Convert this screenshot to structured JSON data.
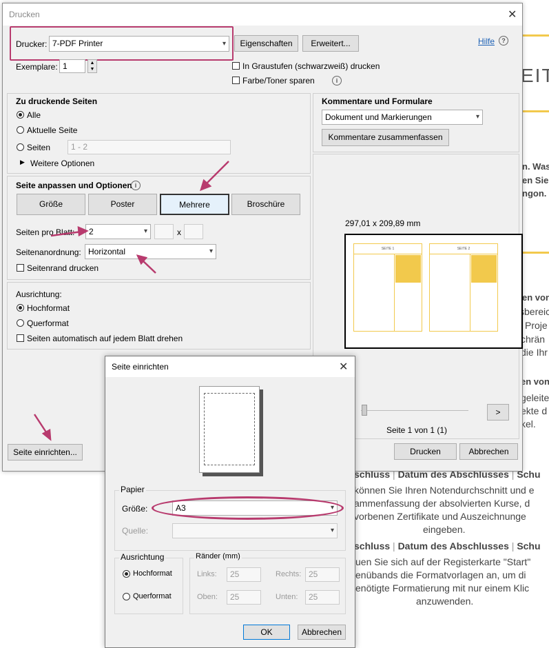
{
  "print_dialog": {
    "title": "Drucken",
    "printer_label": "Drucker:",
    "printer_value": "7-PDF Printer",
    "properties_button": "Eigenschaften",
    "advanced_button": "Erweitert...",
    "help_link": "Hilfe",
    "copies_label": "Exemplare:",
    "copies_value": "1",
    "grayscale_label": "In Graustufen (schwarzweiß) drucken",
    "save_toner_label": "Farbe/Toner sparen",
    "pages_section": {
      "title": "Zu druckende Seiten",
      "all": "Alle",
      "current": "Aktuelle Seite",
      "pages": "Seiten",
      "pages_value": "1 - 2",
      "more_options": "Weitere Optionen"
    },
    "comments_section": {
      "title": "Kommentare und Formulare",
      "select_value": "Dokument und Markierungen",
      "summarize_button": "Kommentare zusammenfassen"
    },
    "fit_section": {
      "title": "Seite anpassen und Optionen",
      "size_button": "Größe",
      "poster_button": "Poster",
      "multiple_button": "Mehrere",
      "booklet_button": "Broschüre",
      "pages_per_sheet_label": "Seiten pro Blatt:",
      "pages_per_sheet_value": "2",
      "times": "x",
      "page_order_label": "Seitenanordnung:",
      "page_order_value": "Horizontal",
      "print_border_label": "Seitenrand drucken"
    },
    "orientation_section": {
      "title": "Ausrichtung:",
      "portrait": "Hochformat",
      "landscape": "Querformat",
      "auto_rotate": "Seiten automatisch auf jedem Blatt drehen"
    },
    "preview": {
      "dimensions": "297,01 x 209,89 mm",
      "page1": "SEITE 1",
      "page2": "SEITE 2",
      "next_button": ">",
      "page_counter": "Seite 1 von 1 (1)"
    },
    "page_setup_button": "Seite einrichten...",
    "print_button": "Drucken",
    "cancel_button": "Abbrechen"
  },
  "page_setup_dialog": {
    "title": "Seite einrichten",
    "paper_group": "Papier",
    "size_label": "Größe:",
    "size_value": "A3",
    "source_label": "Quelle:",
    "source_value": "",
    "orientation_group": "Ausrichtung",
    "portrait": "Hochformat",
    "landscape": "Querformat",
    "margins_group": "Ränder (mm)",
    "left_label": "Links:",
    "left_value": "25",
    "right_label": "Rechts:",
    "right_value": "25",
    "top_label": "Oben:",
    "top_value": "25",
    "bottom_label": "Unten:",
    "bottom_value": "25",
    "ok_button": "OK",
    "cancel_button": "Abbrechen"
  },
  "background_document": {
    "heading_fragment": "EIT",
    "frag1": "n. Was",
    "frag2": "en Sie",
    "frag3": "ngon.",
    "frag4": "en von",
    "frag5": "sbereic",
    "frag6": "Proje",
    "frag7": "chrän",
    "frag8": "die Ihr",
    "frag9": "en von",
    "frag10": "geleite",
    "frag11": "ekte d",
    "frag12": "kel.",
    "line1a": "schluss",
    "sep": "|",
    "line1b": "Datum des Abschlusses",
    "line1c": "Schu",
    "para1_1": "können Sie Ihren Notendurchschnitt und e",
    "para1_2": "ammenfassung der absolvierten Kurse, d",
    "para1_3": "vorbenen Zertifikate und Auszeichnunge",
    "para1_4": "eingeben.",
    "para2_1": "uen Sie sich auf der Registerkarte \"Start\"",
    "para2_2": "enübands die Formatvorlagen an, um di",
    "para2_3": "enötigte Formatierung mit nur einem Klic",
    "para2_4": "anzuwenden."
  },
  "colors": {
    "annotation": "#b83b6e",
    "accent_gold": "#f2c94c",
    "link": "#1a5fb4"
  }
}
